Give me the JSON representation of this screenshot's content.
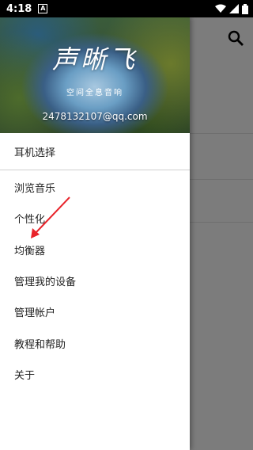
{
  "status": {
    "time": "4:18",
    "notif_icon": "A"
  },
  "header": {
    "title": "声晰飞",
    "subtitle": "空间全息音响",
    "email": "2478132107@qq.com"
  },
  "first_item": "耳机选择",
  "menu": [
    {
      "label": "浏览音乐"
    },
    {
      "label": "个性化"
    },
    {
      "label": "均衡器"
    },
    {
      "label": "管理我的设备"
    },
    {
      "label": "管理帐户"
    },
    {
      "label": "教程和帮助"
    },
    {
      "label": "关于"
    }
  ],
  "colors": {
    "arrow": "#e8232a",
    "overlay": "#7f7f7f"
  }
}
